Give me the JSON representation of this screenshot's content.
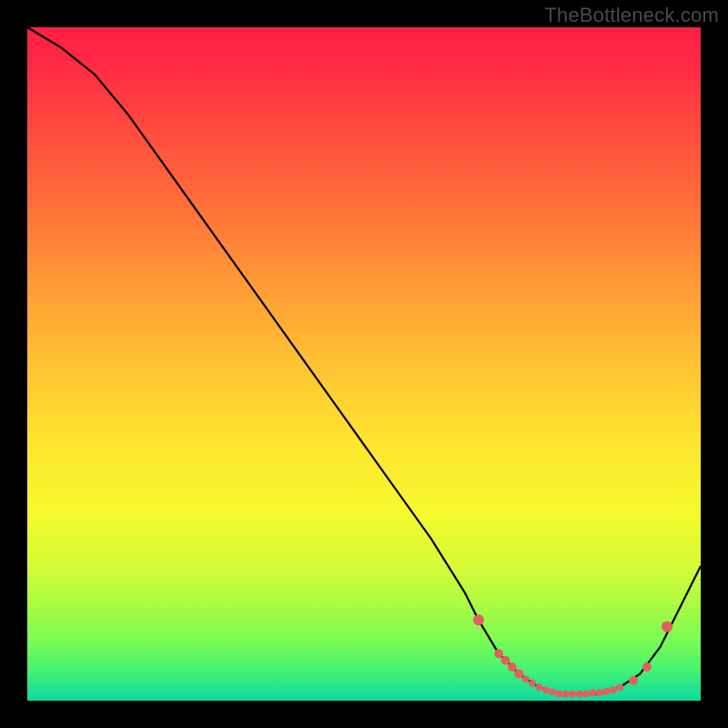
{
  "watermark": "TheBottleneck.com",
  "colors": {
    "frame_bg": "#000000",
    "watermark": "#4a4a4a",
    "curve": "#000000",
    "dot": "#e26060",
    "gradient_top": "#ff1f44",
    "gradient_bottom": "#0fd9a0"
  },
  "chart_data": {
    "type": "line",
    "title": "",
    "xlabel": "",
    "ylabel": "",
    "xlim": [
      0,
      100
    ],
    "ylim": [
      0,
      100
    ],
    "series": [
      {
        "name": "curve",
        "x": [
          0,
          5,
          10,
          15,
          20,
          25,
          30,
          35,
          40,
          45,
          50,
          55,
          60,
          65,
          67,
          70,
          73,
          76,
          79,
          82,
          85,
          88,
          91,
          94,
          97,
          100
        ],
        "values": [
          100,
          97,
          93,
          87,
          80,
          73,
          66,
          59,
          52,
          45,
          38,
          31,
          24,
          16,
          12,
          7,
          4,
          2,
          1,
          1,
          1,
          2,
          4,
          8,
          14,
          20
        ]
      }
    ],
    "markers": {
      "name": "dots",
      "x": [
        67,
        70,
        71,
        72,
        73,
        74,
        75,
        76,
        77,
        78,
        79,
        80,
        81,
        82,
        83,
        84,
        85,
        86,
        87,
        88,
        90,
        92,
        95
      ],
      "values": [
        12,
        7,
        6,
        5,
        4,
        3.2,
        2.6,
        2,
        1.6,
        1.3,
        1,
        1,
        1,
        1,
        1,
        1.2,
        1.2,
        1.4,
        1.6,
        2,
        3,
        5,
        11
      ],
      "size": [
        6,
        5,
        5,
        5,
        5,
        4,
        4,
        4,
        4,
        4,
        4,
        4,
        4,
        4,
        4,
        4,
        4,
        4,
        4,
        4,
        5,
        5,
        6
      ]
    }
  }
}
